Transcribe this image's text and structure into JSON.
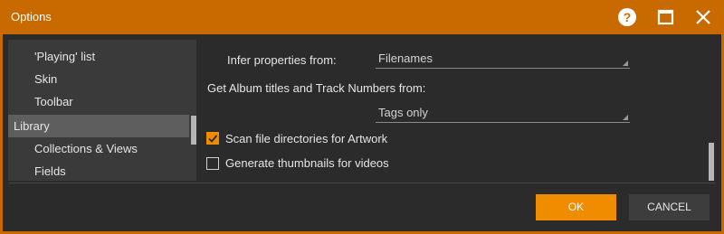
{
  "window": {
    "title": "Options"
  },
  "titlebar": {
    "help_icon": "help-circle-icon",
    "maximize_icon": "maximize-icon",
    "close_icon": "close-icon"
  },
  "nav": {
    "items": [
      {
        "label": "'Playing' list",
        "level": "sub"
      },
      {
        "label": "Skin",
        "level": "sub"
      },
      {
        "label": "Toolbar",
        "level": "sub"
      },
      {
        "label": "Library",
        "level": "top",
        "selected": true
      },
      {
        "label": "Collections & Views",
        "level": "sub"
      },
      {
        "label": "Fields",
        "level": "sub"
      }
    ]
  },
  "settings": {
    "infer_label": "Infer properties from:",
    "infer_value": "Filenames",
    "album_label": "Get Album titles and Track Numbers from:",
    "album_value": "Tags only",
    "scan_label": "Scan file directories for Artwork",
    "scan_checked": true,
    "thumbs_label": "Generate thumbnails for videos",
    "thumbs_checked": false
  },
  "buttons": {
    "ok": "OK",
    "cancel": "CANCEL"
  },
  "colors": {
    "accent": "#f08c00",
    "titlebar": "#c86a00",
    "background": "#2b2b2b"
  }
}
